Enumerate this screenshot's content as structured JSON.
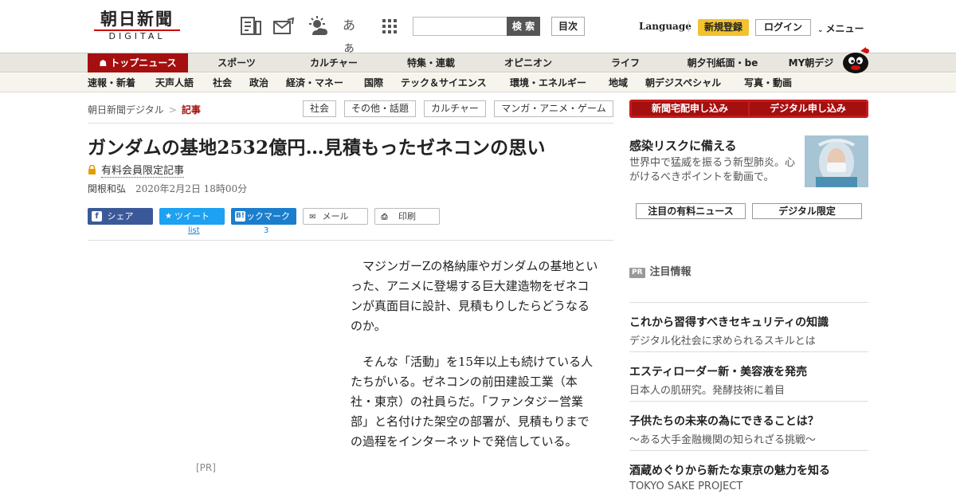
{
  "header": {
    "logo_jp": "朝日新聞",
    "logo_en": "DIGITAL",
    "search_placeholder": "",
    "search_button": "検 索",
    "toc_button": "目次",
    "language": "Language",
    "register": "新規登録",
    "login": "ログイン",
    "menu": "メニュー",
    "icons": [
      "paper-icon",
      "mail-icon",
      "weather-icon",
      "font-size-icon",
      "grid-icon"
    ],
    "font_size_label": "あぁ"
  },
  "nav_main": [
    {
      "label": "トップニュース",
      "active": true
    },
    {
      "label": "スポーツ"
    },
    {
      "label": "カルチャー"
    },
    {
      "label": "特集・連載"
    },
    {
      "label": "オピニオン"
    },
    {
      "label": "ライフ"
    },
    {
      "label": "朝夕刊紙面・be"
    },
    {
      "label": "MY朝デジ"
    }
  ],
  "nav_sub": [
    "速報・新着",
    "天声人語",
    "社会",
    "政治",
    "経済・マネー",
    "国際",
    "テック＆サイエンス",
    "環境・エネルギー",
    "地域",
    "朝デジスペシャル",
    "写真・動画"
  ],
  "breadcrumb": {
    "home": "朝日新聞デジタル",
    "sep": ">",
    "current": "記事"
  },
  "tags": [
    "社会",
    "その他・話題",
    "カルチャー",
    "マンガ・アニメ・ゲーム"
  ],
  "article": {
    "title": "ガンダムの基地2532億円…見積もったゼネコンの思い",
    "paid_label": "有料会員限定記事",
    "author": "関根和弘",
    "date": "2020年2月2日 18時00分",
    "paragraphs": [
      "マジンガーZの格納庫やガンダムの基地といった、アニメに登場する巨大建造物をゼネコンが真面目に設計、見積もりしたらどうなるのか。",
      "そんな「活動」を15年以上も続けている人たちがいる。ゼネコンの前田建設工業（本社・東京）の社員らだ。「ファンタジー営業部」と名付けた架空の部署が、見積もりまでの過程をインターネットで発信している。"
    ],
    "ad_label": "[PR]"
  },
  "share": {
    "facebook": "シェア",
    "twitter": "ツイート",
    "twitter_count": "list",
    "hatena": "ブックマーク",
    "hatena_count": "3",
    "mail": "メール",
    "print": "印刷"
  },
  "sidebar": {
    "subscribe_paper": "新聞宅配申し込み",
    "subscribe_digital": "デジタル申し込み",
    "promo_title": "感染リスクに備える",
    "promo_desc": "世界中で猛威を振るう新型肺炎。心がけるべきポイントを動画で。",
    "btn_featured": "注目の有料ニュース",
    "btn_digital_only": "デジタル限定",
    "pr_badge": "PR",
    "pr_heading": "注目情報",
    "pr_items": [
      {
        "title": "これから習得すべきセキュリティの知識",
        "sub": "デジタル化社会に求められるスキルとは"
      },
      {
        "title": "エスティローダー新・美容液を発売",
        "sub": "日本人の肌研究。発酵技術に着目"
      },
      {
        "title": "子供たちの未来の為にできることは？",
        "sub": "～ある大手金融機関の知られざる挑戦～"
      },
      {
        "title": "酒蔵めぐりから新たな東京の魅力を知る",
        "sub": "TOKYO SAKE PROJECT"
      }
    ]
  },
  "colors": {
    "brand_red": "#a50f0f",
    "register_yellow": "#f2c230",
    "facebook": "#3b5998",
    "twitter": "#1da1f2",
    "hatena": "#1b7ecd"
  }
}
